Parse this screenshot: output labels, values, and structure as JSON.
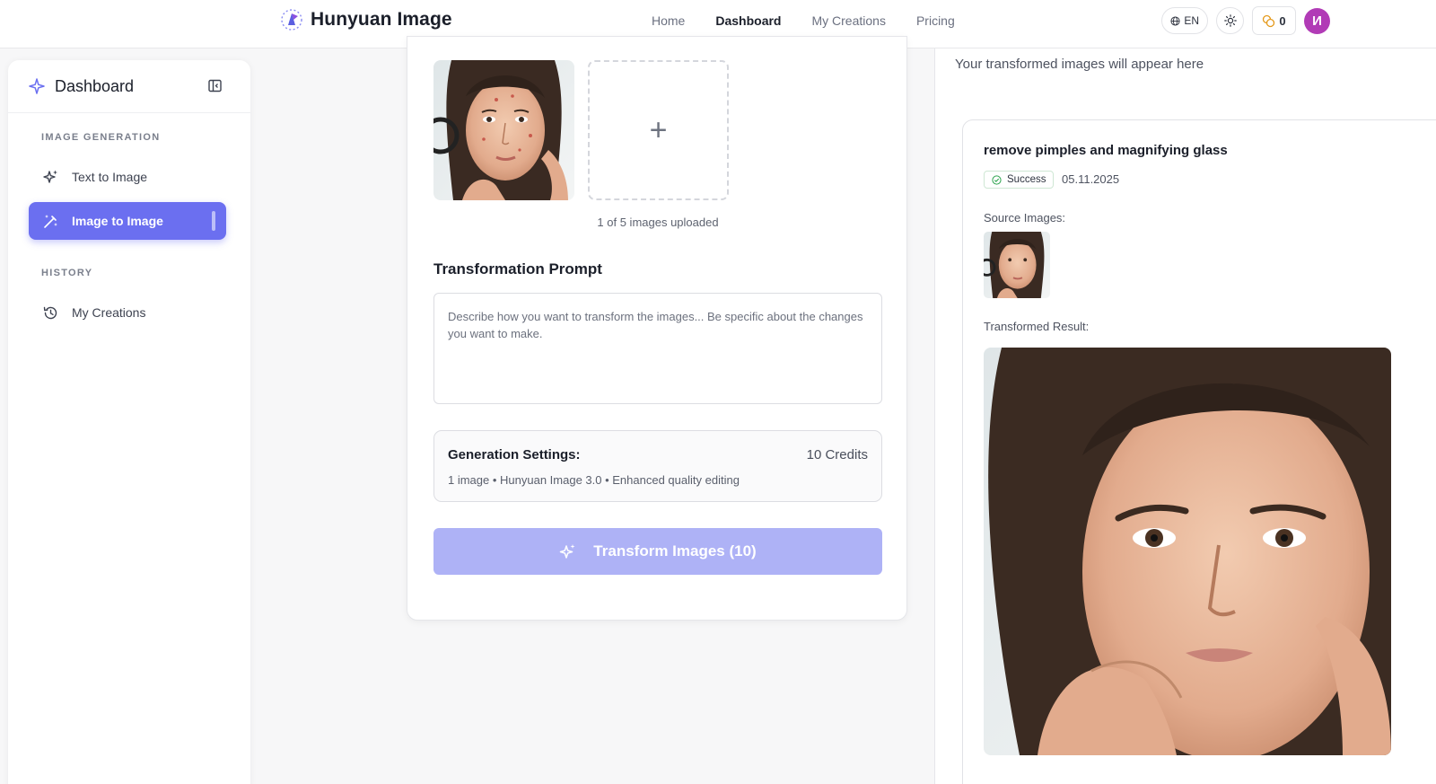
{
  "header": {
    "app_name": "Hunyuan Image",
    "nav": [
      {
        "label": "Home",
        "active": false
      },
      {
        "label": "Dashboard",
        "active": true
      },
      {
        "label": "My Creations",
        "active": false
      },
      {
        "label": "Pricing",
        "active": false
      }
    ],
    "language": "EN",
    "credits": "0",
    "avatar_initial": "И",
    "accent_color": "#6b6ff0",
    "avatar_color": "#b13bb6"
  },
  "sidebar": {
    "title": "Dashboard",
    "sections": [
      {
        "heading": "IMAGE GENERATION",
        "items": [
          {
            "label": "Text to Image",
            "icon": "sparkles-icon",
            "active": false
          },
          {
            "label": "Image to Image",
            "icon": "magic-wand-icon",
            "active": true
          }
        ]
      },
      {
        "heading": "HISTORY",
        "items": [
          {
            "label": "My Creations",
            "icon": "history-icon",
            "active": false
          }
        ]
      }
    ]
  },
  "editor": {
    "upload_count": "1 of 5 images uploaded",
    "add_symbol": "+",
    "prompt_label": "Transformation Prompt",
    "prompt_placeholder": "Describe how you want to transform the images... Be specific about the changes you want to make.",
    "settings_title": "Generation Settings:",
    "settings_credits": "10 Credits",
    "settings_desc": "1 image • Hunyuan Image 3.0 • Enhanced quality editing",
    "transform_button": "Transform Images (10)"
  },
  "results": {
    "subtitle": "Your transformed images will appear here",
    "item": {
      "prompt": "remove pimples and magnifying glass",
      "status": "Success",
      "date": "05.11.2025",
      "source_label": "Source Images:",
      "result_label": "Transformed Result:"
    }
  }
}
